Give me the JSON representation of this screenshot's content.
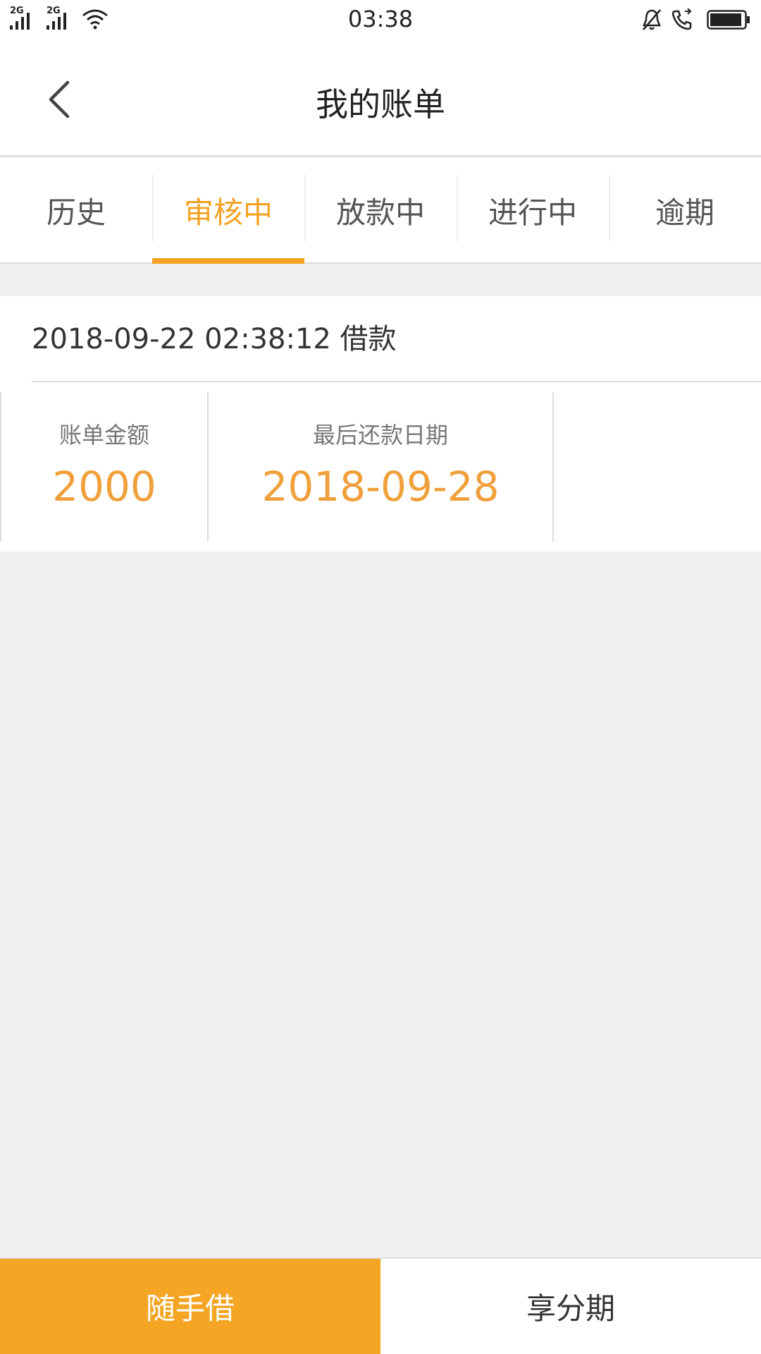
{
  "status_bar": {
    "time": "03:38",
    "sim1_label": "2G",
    "sim2_label": "2G",
    "icons": [
      "signal-icon",
      "wifi-icon",
      "mute-bell-icon",
      "call-icon",
      "battery-icon"
    ]
  },
  "header": {
    "title": "我的账单",
    "back_icon": "chevron-left-icon"
  },
  "tabs": [
    {
      "label": "历史",
      "active": false
    },
    {
      "label": "审核中",
      "active": true
    },
    {
      "label": "放款中",
      "active": false
    },
    {
      "label": "进行中",
      "active": false
    },
    {
      "label": "逾期",
      "active": false
    }
  ],
  "bill": {
    "header": "2018-09-22 02:38:12 借款",
    "amount_label": "账单金额",
    "amount_value": "2000",
    "due_label": "最后还款日期",
    "due_value": "2018-09-28"
  },
  "bottom_nav": {
    "left_label": "随手借",
    "right_label": "享分期"
  },
  "colors": {
    "accent": "#f3a222",
    "value_orange": "#f0a03b",
    "background": "#f0f0f0"
  }
}
